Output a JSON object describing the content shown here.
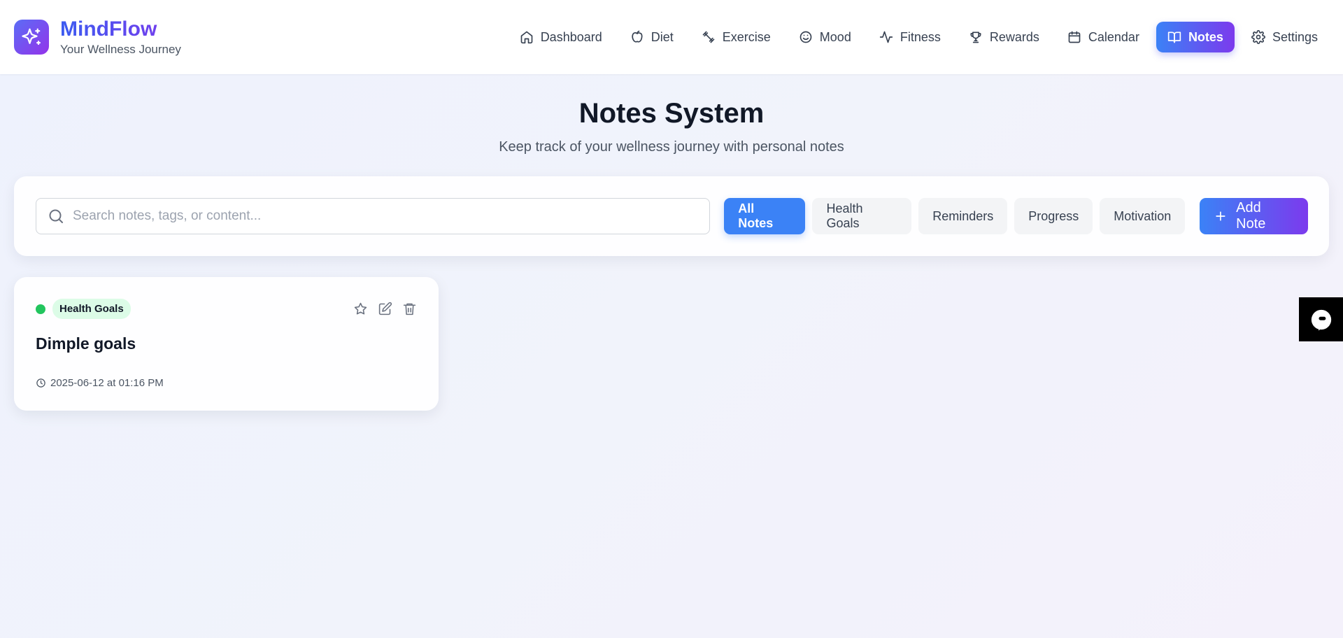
{
  "brand": {
    "name": "MindFlow",
    "tagline": "Your Wellness Journey"
  },
  "nav": {
    "items": [
      {
        "label": "Dashboard",
        "icon": "home-icon"
      },
      {
        "label": "Diet",
        "icon": "apple-icon"
      },
      {
        "label": "Exercise",
        "icon": "dumbbell-icon"
      },
      {
        "label": "Mood",
        "icon": "smile-icon"
      },
      {
        "label": "Fitness",
        "icon": "activity-icon"
      },
      {
        "label": "Rewards",
        "icon": "trophy-icon"
      },
      {
        "label": "Calendar",
        "icon": "calendar-icon"
      },
      {
        "label": "Notes",
        "icon": "book-icon",
        "active": true
      },
      {
        "label": "Settings",
        "icon": "gear-icon"
      }
    ]
  },
  "page": {
    "title": "Notes System",
    "subtitle": "Keep track of your wellness journey with personal notes"
  },
  "search": {
    "placeholder": "Search notes, tags, or content..."
  },
  "filters": {
    "all": "All Notes",
    "health_goals": "Health Goals",
    "reminders": "Reminders",
    "progress": "Progress",
    "motivation": "Motivation",
    "active": "All Notes"
  },
  "add_button": {
    "label": "Add Note"
  },
  "notes": [
    {
      "tag": "Health Goals",
      "tag_color": "#22c55e",
      "title": "Dimple goals",
      "timestamp": "2025-06-12 at 01:16 PM"
    }
  ],
  "colors": {
    "accent_blue": "#3b82f6",
    "accent_purple": "#7c3aed",
    "tag_green": "#22c55e"
  }
}
